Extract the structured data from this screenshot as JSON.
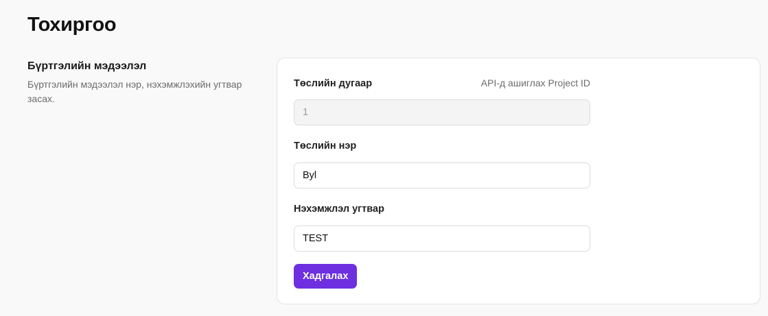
{
  "page": {
    "title": "Тохиргоо"
  },
  "section": {
    "title": "Бүртгэлийн мэдээлэл",
    "description": "Бүртгэлийн мэдээлэл нэр, нэхэмжлэхийн угтвар засах."
  },
  "form": {
    "project_number": {
      "label": "Төслийн дугаар",
      "hint": "API-д ашиглах Project ID",
      "value": "1"
    },
    "project_name": {
      "label": "Төслийн нэр",
      "value": "Byl"
    },
    "invoice_prefix": {
      "label": "Нэхэмжлэл угтвар",
      "value": "TEST"
    },
    "save_label": "Хадгалах"
  },
  "colors": {
    "accent": "#6d2fe0",
    "background": "#f9f9f9",
    "card": "#ffffff"
  }
}
